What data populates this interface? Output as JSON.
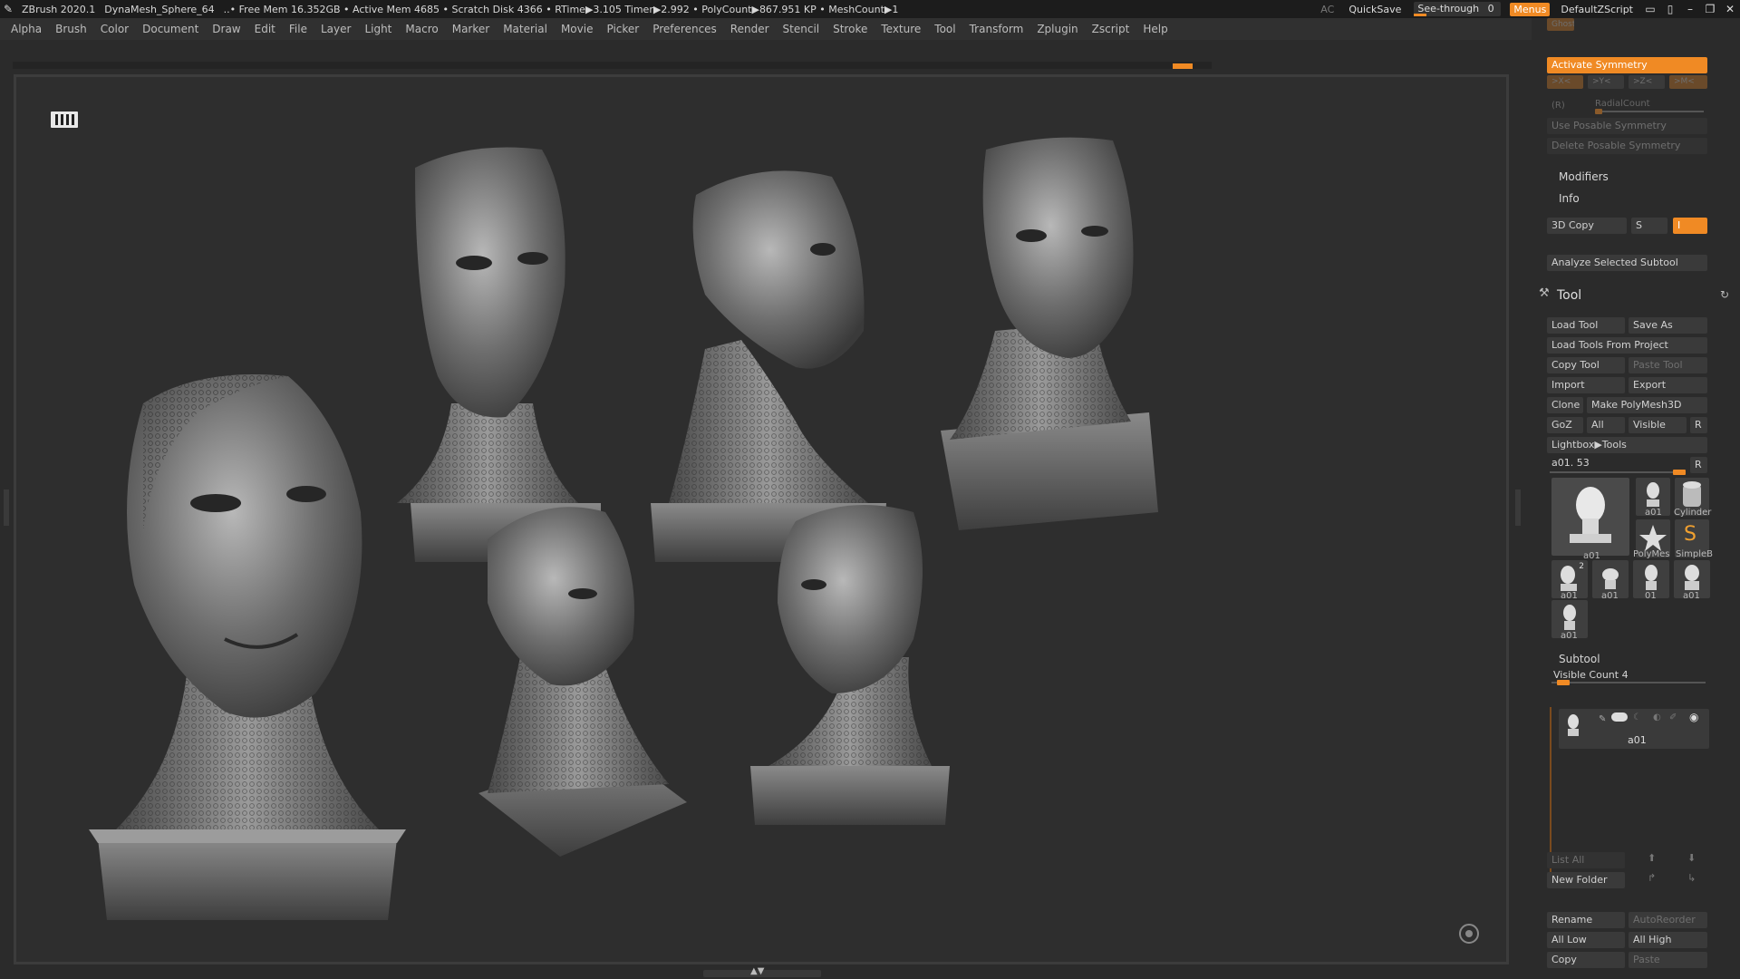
{
  "titlebar": {
    "app": "ZBrush 2020.1",
    "document": "DynaMesh_Sphere_64",
    "stats": "..• Free Mem 16.352GB • Active Mem 4685 • Scratch Disk 4366 •  RTime▶3.105 Timer▶2.992 • PolyCount▶867.951 KP • MeshCount▶1",
    "ac": "AC",
    "quicksave": "QuickSave",
    "see_through_label": "See-through",
    "see_through_value": "0",
    "menus": "Menus",
    "script": "DefaultZScript"
  },
  "menubar": [
    "Alpha",
    "Brush",
    "Color",
    "Document",
    "Draw",
    "Edit",
    "File",
    "Layer",
    "Light",
    "Macro",
    "Marker",
    "Material",
    "Movie",
    "Picker",
    "Preferences",
    "Render",
    "Stencil",
    "Stroke",
    "Texture",
    "Tool",
    "Transform",
    "Zplugin",
    "Zscript",
    "Help"
  ],
  "right_panel": {
    "ghost": "Ghost",
    "activate_symmetry": "Activate Symmetry",
    "axes": [
      ">X<",
      ">Y<",
      ">Z<",
      ">M<"
    ],
    "r_label": "(R)",
    "radial_count": "RadialCount",
    "use_posable_symmetry": "Use Posable Symmetry",
    "delete_posable_symmetry": "Delete Posable Symmetry",
    "modifiers": "Modifiers",
    "info": "Info",
    "copy3d": "3D Copy",
    "s_label": "S",
    "i_label": "I",
    "analyze": "Analyze Selected Subtool",
    "tool_title": "Tool",
    "load_tool": "Load Tool",
    "save_as": "Save As",
    "load_from_project": "Load Tools From Project",
    "copy_tool": "Copy Tool",
    "paste_tool": "Paste Tool",
    "import": "Import",
    "export": "Export",
    "clone": "Clone",
    "make_polymesh": "Make PolyMesh3D",
    "goz": "GoZ",
    "all": "All",
    "visible": "Visible",
    "r": "R",
    "lightbox": "Lightbox▶Tools",
    "current_tool": "a01. 53",
    "thumbs": {
      "main": "a01",
      "t1": "a01",
      "t2": "Cylinder",
      "t3": "PolyMes",
      "t4": "SimpleB",
      "t5": "a01",
      "t6": "a01",
      "t7": "01",
      "t8": "a01",
      "t9": "a01",
      "badge": "2"
    },
    "subtool": "Subtool",
    "visible_count": "Visible Count 4",
    "subtool_name": "a01",
    "list_all": "List All",
    "new_folder": "New Folder",
    "rename": "Rename",
    "auto_reorder": "AutoReorder",
    "all_low": "All Low",
    "all_high": "All High",
    "copy": "Copy",
    "paste": "Paste"
  },
  "colors": {
    "accent": "#f08a24",
    "background": "#2b2b2b",
    "viewport": "#2e2e2e"
  }
}
